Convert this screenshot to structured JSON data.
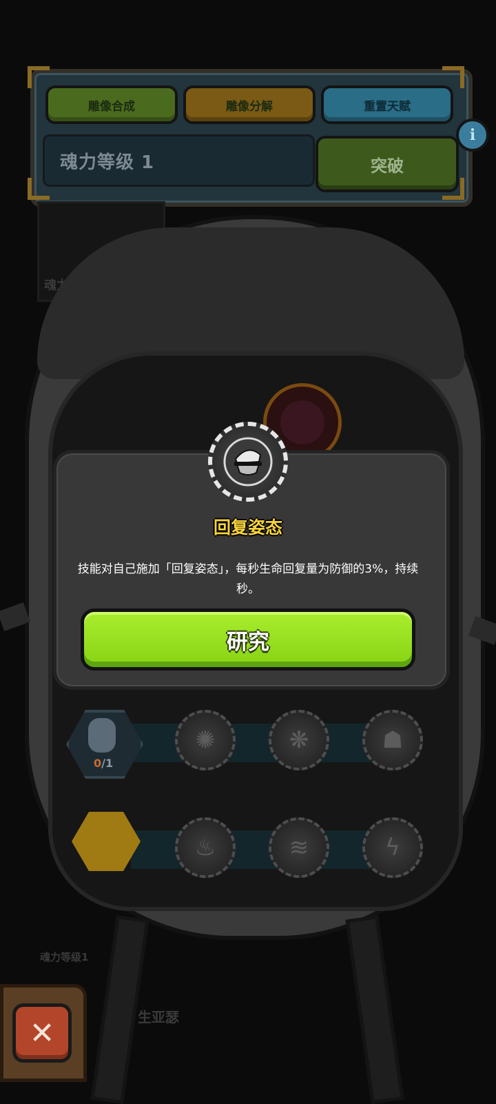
{
  "top_panel": {
    "tabs": [
      {
        "label": "雕像合成",
        "color": "#4a6b1e"
      },
      {
        "label": "雕像分解",
        "color": "#7a5a14"
      },
      {
        "label": "重置天赋",
        "color": "#2a6d86"
      }
    ],
    "soul_level": "魂力等级 1",
    "breakthrough_label": "突破",
    "info_glyph": "i"
  },
  "background": {
    "soul_text": "魂力",
    "soul_level_small": "魂力等级1",
    "vitality_text": "生亚瑟"
  },
  "talent_tree": {
    "rows": [
      {
        "statue_counter_current": "0",
        "statue_counter_total": "/1",
        "nodes": [
          "storm-icon",
          "tentacle-icon",
          "creature-icon"
        ]
      },
      {
        "nodes": [
          "flame-icon",
          "wave-icon",
          "lightning-icon"
        ]
      }
    ]
  },
  "modal": {
    "skill_name": "回复姿态",
    "description": "技能对自己施加「回复姿态」，每秒生命回复量为防御的3%，持续秒。",
    "research_label": "研究",
    "badge_icon": "warrior-icon"
  },
  "close_label": "✕",
  "colors": {
    "accent_green": "#9be31f",
    "title_yellow": "#f6d33c",
    "close_red": "#b3452a"
  }
}
